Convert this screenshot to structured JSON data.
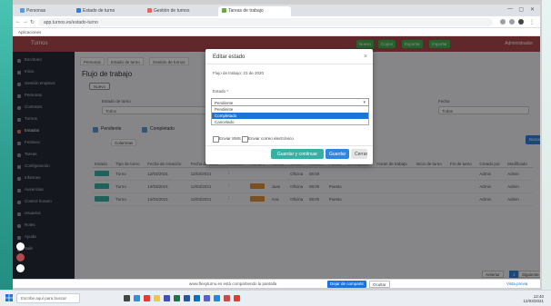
{
  "browser": {
    "tabs": [
      {
        "label": "Personas",
        "color": "#5b9bd5"
      },
      {
        "label": "Estado de turno",
        "color": "#3c78d8"
      },
      {
        "label": "Gestión de turnos",
        "color": "#e06666"
      },
      {
        "label": "Tareas de trabajo",
        "color": "#6aa84f"
      }
    ],
    "window_controls": [
      "—",
      "▢",
      "✕"
    ],
    "url": "app.turnos.es/estado-turno",
    "bookmarks_label": "Aplicaciones"
  },
  "app": {
    "brand": "Turnos",
    "top_buttons": [
      {
        "label": "Nuevo",
        "color": "#43a047"
      },
      {
        "label": "Copiar",
        "color": "#43a047"
      },
      {
        "label": "Exportar",
        "color": "#43a047"
      },
      {
        "label": "Importar",
        "color": "#43a047"
      }
    ],
    "user": "Administrador",
    "accent": "#b04a4d"
  },
  "sidebar": {
    "items": [
      {
        "label": "Escritorio",
        "active": false
      },
      {
        "label": "Inicio",
        "active": false
      },
      {
        "label": "Gestión empleos",
        "active": false
      },
      {
        "label": "Personas",
        "active": false
      },
      {
        "label": "Contratos",
        "active": false
      },
      {
        "label": "Turnos",
        "active": false
      },
      {
        "label": "Estados",
        "active": true
      },
      {
        "label": "Festivos",
        "active": false
      },
      {
        "label": "Tareas",
        "active": false
      },
      {
        "label": "Configuración",
        "active": false
      },
      {
        "label": "Informes",
        "active": false
      },
      {
        "label": "Ausencias",
        "active": false
      },
      {
        "label": "Control horario",
        "active": false
      },
      {
        "label": "Usuarios",
        "active": false
      },
      {
        "label": "Roles",
        "active": false
      },
      {
        "label": "Ayuda",
        "active": false
      },
      {
        "label": "Salir",
        "active": false
      }
    ]
  },
  "content": {
    "tabs": [
      "Personas",
      "Estado de turno",
      "Gestión de turnos"
    ],
    "title": "Flujo de trabajo",
    "new_button": "Nuevo",
    "filters": [
      {
        "label": "Estado de turno",
        "value": "Todos"
      },
      {
        "label": "Fecha",
        "value": "Todas"
      }
    ],
    "checks": [
      "Pendiente",
      "Completado"
    ],
    "toolbar": [
      "Columnas",
      "Filtrar",
      "Exportar",
      "Imprimir"
    ],
    "search_button": "Buscar",
    "table": {
      "headers": [
        "Estado",
        "Tipo de turno",
        "Fecha de creación",
        "Fecha de inicio",
        "Acciones",
        "Nombre",
        "Turnos",
        "Centro",
        "Horario",
        "Puesto",
        "Descripción",
        "Horas de trabajo",
        "Inicio de turno",
        "Fin de turno",
        "Creado por",
        "Modificado"
      ],
      "rows": [
        {
          "state_color": "#35b1a4",
          "cells": [
            "Turno",
            "12/03/2021",
            "12/03/2021",
            "⋮",
            "",
            "",
            "Oficina",
            "08:00",
            "",
            "",
            "",
            "",
            "",
            "Admin",
            "Admin"
          ]
        },
        {
          "state_color": "#35b1a4",
          "cells": [
            "Turno",
            "12/03/2021",
            "12/03/2021",
            "⋮",
            "",
            "Juan",
            "Oficina",
            "08:00",
            "Puesto",
            "",
            "",
            "",
            "",
            "Admin",
            "Admin"
          ]
        },
        {
          "state_color": "#35b1a4",
          "cells": [
            "Turno",
            "12/03/2021",
            "12/03/2021",
            "⋮",
            "",
            "Ana",
            "Oficina",
            "08:00",
            "Puesto",
            "",
            "",
            "",
            "",
            "Admin",
            "Admin"
          ]
        }
      ],
      "row_tags": [
        "",
        "#e69138",
        "#e69138"
      ]
    },
    "pager": [
      "Anterior",
      "1",
      "Siguiente"
    ]
  },
  "modal": {
    "title": "Editar estado",
    "info_label": "Flujo de trabajo: 23 de 2020",
    "field_label": "Estado *",
    "selected": "Pendiente",
    "options": [
      "Pendiente",
      "Completado",
      "Cancelado"
    ],
    "highlighted_index": 1,
    "checkboxes": [
      "Enviar SMS",
      "Enviar correo electrónico"
    ],
    "buttons": [
      {
        "label": "Guardar y continuar",
        "bg": "#35b1a4",
        "color": "#ffffff"
      },
      {
        "label": "Guardar",
        "bg": "#2e86de",
        "color": "#ffffff"
      },
      {
        "label": "Cerrar",
        "bg": "#e4e4e4",
        "color": "#444444"
      }
    ]
  },
  "notification": {
    "text": "www.flexyturno.es está compartiendo la pantalla",
    "share_button": "Dejar de compartir",
    "hide_button": "Ocultar",
    "right_label": "Vista previa"
  },
  "taskbar": {
    "search_placeholder": "Escribe aquí para buscar",
    "icons": [
      {
        "name": "task-view-icon",
        "color": "#444444"
      },
      {
        "name": "edge-icon",
        "color": "#2f8fd8"
      },
      {
        "name": "chrome-icon",
        "color": "#e53935"
      },
      {
        "name": "explorer-icon",
        "color": "#f4c542"
      },
      {
        "name": "store-icon",
        "color": "#3f51b5"
      },
      {
        "name": "excel-icon",
        "color": "#217346"
      },
      {
        "name": "word-icon",
        "color": "#2b579a"
      },
      {
        "name": "outlook-icon",
        "color": "#0072c6"
      },
      {
        "name": "teams-icon",
        "color": "#5b5fc7"
      },
      {
        "name": "mail-icon",
        "color": "#1e88e5"
      },
      {
        "name": "photos-icon",
        "color": "#c0504d"
      },
      {
        "name": "chrome2-icon",
        "color": "#e53935"
      }
    ],
    "time": "12:40",
    "date": "12/03/2021"
  }
}
